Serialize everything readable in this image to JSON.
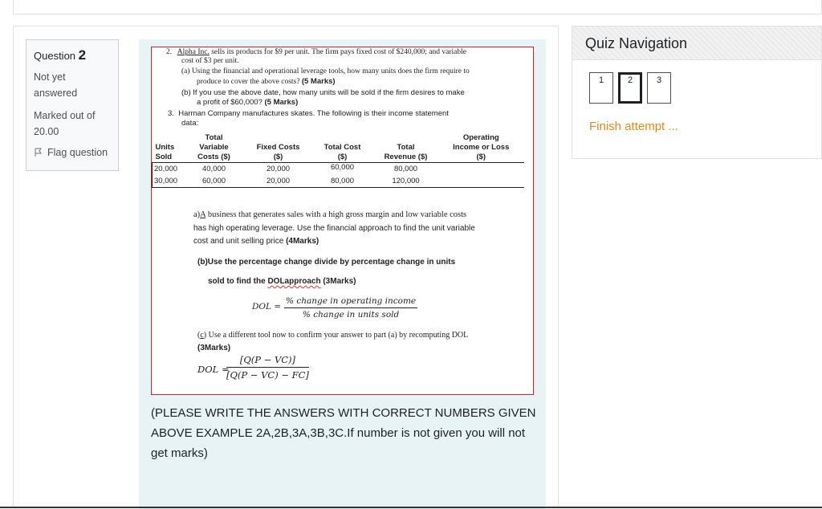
{
  "question_info": {
    "question_prefix": "Question",
    "question_number": "2",
    "status": "Not yet answered",
    "marked_out_of": "Marked out of 20.00",
    "flag_label": "Flag question"
  },
  "question_content": {
    "q2": {
      "number": "2.",
      "line1_company": "Alpha Inc.",
      "line1_rest": " sells its products for $9 per unit. The firm pays fixed cost of $240,000; and variable",
      "line2": "cost of $3 per unit.",
      "a_line1": "(a)  Using the financial and operational leverage tools, how many units does the firm require to",
      "a_line2_text": "produce to cover the above costs? ",
      "a_line2_marks": "(5 Marks)",
      "b_line1": "(b)  If you use the above date, how many units will be sold if the firm desires to make",
      "b_line2_text": "a profit of $60,000? ",
      "b_line2_marks": "(5 Marks)"
    },
    "q3": {
      "number": "3.",
      "line1": "Harman Company manufactures skates. The following is their income statement",
      "line2": "data:"
    },
    "table": {
      "headers": [
        [
          "Units",
          "Sold"
        ],
        [
          "Total",
          "Variable",
          "Costs ($)"
        ],
        [
          "Fixed Costs",
          "($)"
        ],
        [
          "Total Cost",
          "($)"
        ],
        [
          "Total",
          "Revenue ($)"
        ],
        [
          "Operating",
          "Income or Loss",
          "($)"
        ]
      ],
      "rows": [
        [
          "20,000",
          "40,000",
          "20,000",
          "60,000",
          "80,000",
          ""
        ],
        [
          "30,000",
          "60,000",
          "20,000",
          "80,000",
          "120,000",
          ""
        ]
      ]
    },
    "part_a": {
      "prefix": "a)",
      "a_underlined": "A",
      "line1_rest": " business that generates sales with a high gross margin and low variable costs",
      "line2": "has high operating leverage. Use the financial approach to find the unit variable",
      "line3_text": "cost and unit selling price ",
      "line3_marks": "(4Marks)"
    },
    "part_b": {
      "line1": "(b)Use the percentage change divide by percentage change in units",
      "line2_pre": "sold to find the ",
      "line2_wavy": "DOLapproach",
      "line2_post": " (3Marks)",
      "formula_lhs": "DOL =",
      "formula_num": "% change in operating income",
      "formula_den": "% change in units sold"
    },
    "part_c": {
      "prefix": "(",
      "c_underlined": "c",
      "line1_rest": ") Use a different tool now to confirm your answer to part (a) by recomputing DOL",
      "line2": "(3Marks)",
      "formula_lhs": "DOL =",
      "formula_num": "[Q(P − VC)]",
      "formula_den": "[Q(P − VC) − FC]"
    }
  },
  "note": "(PLEASE WRITE THE ANSWERS WITH CORRECT NUMBERS GIVEN ABOVE EXAMPLE 2A,2B,3A,3B,3C.If number is not given you will not get marks)",
  "quiz_nav": {
    "title": "Quiz Navigation",
    "buttons": [
      "1",
      "2",
      "3"
    ],
    "current": "2",
    "finish_label": "Finish attempt ..."
  },
  "colors": {
    "accent_finish": "#e08a1e",
    "content_bg": "#e7f3f5",
    "image_border": "#e02020"
  }
}
